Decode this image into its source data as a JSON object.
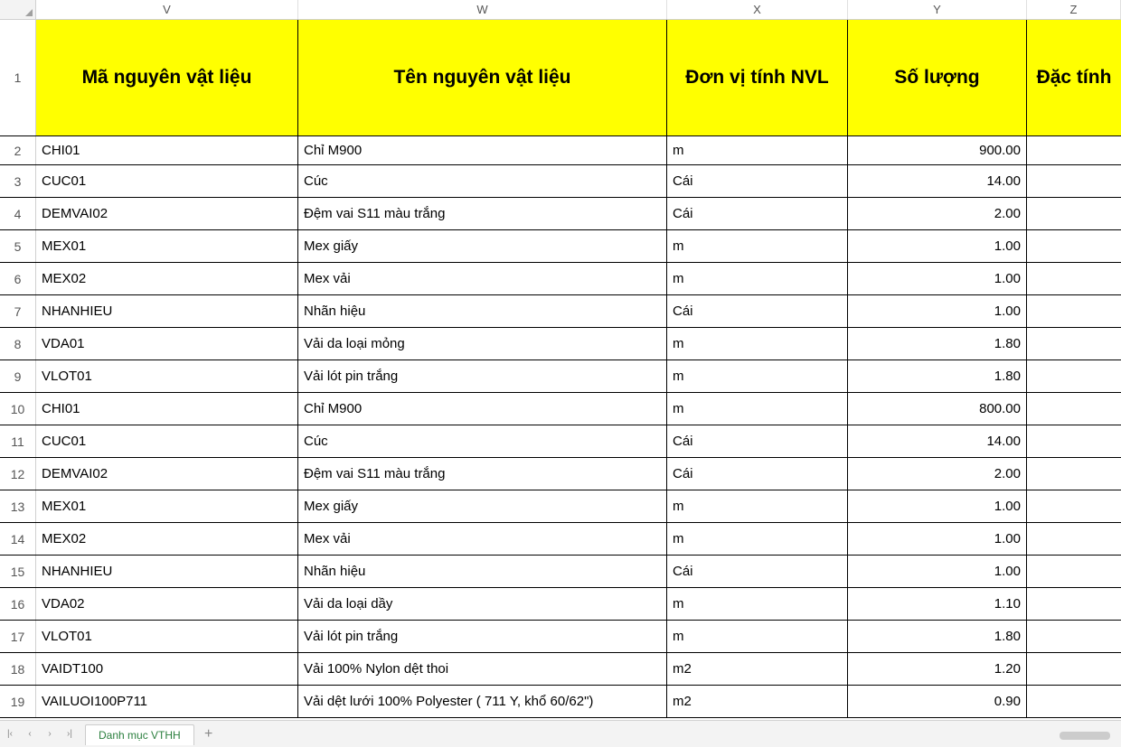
{
  "columns": [
    "V",
    "W",
    "X",
    "Y",
    "Z"
  ],
  "headers": {
    "V": "Mã nguyên vật liệu",
    "W": "Tên nguyên vật liệu",
    "X": "Đơn vị tính NVL",
    "Y": "Số lượng",
    "Z": "Đặc tính"
  },
  "rows": [
    {
      "n": "2",
      "V": "CHI01",
      "W": "Chỉ M900",
      "X": "m",
      "Y": "900.00",
      "Z": ""
    },
    {
      "n": "3",
      "V": "CUC01",
      "W": "Cúc",
      "X": "Cái",
      "Y": "14.00",
      "Z": ""
    },
    {
      "n": "4",
      "V": "DEMVAI02",
      "W": "Đệm vai S11 màu trắng",
      "X": "Cái",
      "Y": "2.00",
      "Z": ""
    },
    {
      "n": "5",
      "V": "MEX01",
      "W": "Mex giấy",
      "X": "m",
      "Y": "1.00",
      "Z": ""
    },
    {
      "n": "6",
      "V": "MEX02",
      "W": "Mex vải",
      "X": "m",
      "Y": "1.00",
      "Z": ""
    },
    {
      "n": "7",
      "V": "NHANHIEU",
      "W": "Nhãn hiệu",
      "X": "Cái",
      "Y": "1.00",
      "Z": ""
    },
    {
      "n": "8",
      "V": "VDA01",
      "W": "Vải da loại mỏng",
      "X": "m",
      "Y": "1.80",
      "Z": ""
    },
    {
      "n": "9",
      "V": "VLOT01",
      "W": "Vải lót pin trắng",
      "X": "m",
      "Y": "1.80",
      "Z": ""
    },
    {
      "n": "10",
      "V": "CHI01",
      "W": "Chỉ M900",
      "X": "m",
      "Y": "800.00",
      "Z": ""
    },
    {
      "n": "11",
      "V": "CUC01",
      "W": "Cúc",
      "X": "Cái",
      "Y": "14.00",
      "Z": ""
    },
    {
      "n": "12",
      "V": "DEMVAI02",
      "W": "Đệm vai S11 màu trắng",
      "X": "Cái",
      "Y": "2.00",
      "Z": ""
    },
    {
      "n": "13",
      "V": "MEX01",
      "W": "Mex giấy",
      "X": "m",
      "Y": "1.00",
      "Z": ""
    },
    {
      "n": "14",
      "V": "MEX02",
      "W": "Mex vải",
      "X": "m",
      "Y": "1.00",
      "Z": ""
    },
    {
      "n": "15",
      "V": "NHANHIEU",
      "W": "Nhãn hiệu",
      "X": "Cái",
      "Y": "1.00",
      "Z": ""
    },
    {
      "n": "16",
      "V": "VDA02",
      "W": "Vải da loại dầy",
      "X": "m",
      "Y": "1.10",
      "Z": ""
    },
    {
      "n": "17",
      "V": "VLOT01",
      "W": "Vải lót pin trắng",
      "X": "m",
      "Y": "1.80",
      "Z": ""
    },
    {
      "n": "18",
      "V": "VAIDT100",
      "W": "Vải 100% Nylon dệt thoi",
      "X": "m2",
      "Y": "1.20",
      "Z": ""
    },
    {
      "n": "19",
      "V": "VAILUOI100P711",
      "W": "Vải dệt lưới 100% Polyester ( 711 Y, khổ 60/62\")",
      "X": "m2",
      "Y": "0.90",
      "Z": ""
    }
  ],
  "tab": {
    "name": "Danh mục VTHH"
  },
  "chart_data": {
    "type": "table",
    "title": "Danh mục VTHH",
    "columns": [
      "Mã nguyên vật liệu",
      "Tên nguyên vật liệu",
      "Đơn vị tính NVL",
      "Số lượng",
      "Đặc tính"
    ],
    "data": [
      [
        "CHI01",
        "Chỉ M900",
        "m",
        900.0,
        ""
      ],
      [
        "CUC01",
        "Cúc",
        "Cái",
        14.0,
        ""
      ],
      [
        "DEMVAI02",
        "Đệm vai S11 màu trắng",
        "Cái",
        2.0,
        ""
      ],
      [
        "MEX01",
        "Mex giấy",
        "m",
        1.0,
        ""
      ],
      [
        "MEX02",
        "Mex vải",
        "m",
        1.0,
        ""
      ],
      [
        "NHANHIEU",
        "Nhãn hiệu",
        "Cái",
        1.0,
        ""
      ],
      [
        "VDA01",
        "Vải da loại mỏng",
        "m",
        1.8,
        ""
      ],
      [
        "VLOT01",
        "Vải lót pin trắng",
        "m",
        1.8,
        ""
      ],
      [
        "CHI01",
        "Chỉ M900",
        "m",
        800.0,
        ""
      ],
      [
        "CUC01",
        "Cúc",
        "Cái",
        14.0,
        ""
      ],
      [
        "DEMVAI02",
        "Đệm vai S11 màu trắng",
        "Cái",
        2.0,
        ""
      ],
      [
        "MEX01",
        "Mex giấy",
        "m",
        1.0,
        ""
      ],
      [
        "MEX02",
        "Mex vải",
        "m",
        1.0,
        ""
      ],
      [
        "NHANHIEU",
        "Nhãn hiệu",
        "Cái",
        1.0,
        ""
      ],
      [
        "VDA02",
        "Vải da loại dầy",
        "m",
        1.1,
        ""
      ],
      [
        "VLOT01",
        "Vải lót pin trắng",
        "m",
        1.8,
        ""
      ],
      [
        "VAIDT100",
        "Vải 100% Nylon dệt thoi",
        "m2",
        1.2,
        ""
      ],
      [
        "VAILUOI100P711",
        "Vải dệt lưới 100% Polyester ( 711 Y, khổ 60/62\")",
        "m2",
        0.9,
        ""
      ]
    ]
  }
}
